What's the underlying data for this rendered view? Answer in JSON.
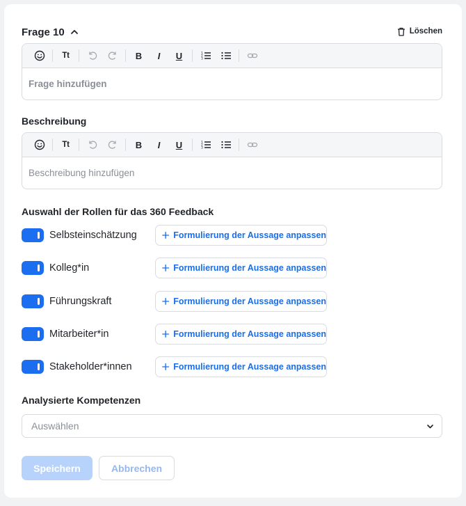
{
  "question": {
    "title": "Frage 10",
    "delete_label": "Löschen",
    "editor_placeholder": "Frage hinzufügen"
  },
  "description": {
    "label": "Beschreibung",
    "editor_placeholder": "Beschreibung hinzufügen"
  },
  "toolbar": {
    "textsize_label": "Tt",
    "bold_label": "B",
    "italic_label": "I",
    "underline_label": "U"
  },
  "roles": {
    "label": "Auswahl der Rollen für das 360 Feedback",
    "adjust_label": "Formulierung der Aussage anpassen",
    "items": [
      {
        "label": "Selbsteinschätzung",
        "enabled": true
      },
      {
        "label": "Kolleg*in",
        "enabled": true
      },
      {
        "label": "Führungskraft",
        "enabled": true
      },
      {
        "label": "Mitarbeiter*in",
        "enabled": true
      },
      {
        "label": "Stakeholder*innen",
        "enabled": true
      }
    ]
  },
  "competencies": {
    "label": "Analysierte Kompetenzen",
    "placeholder": "Auswählen"
  },
  "actions": {
    "save_label": "Speichern",
    "cancel_label": "Abbrechen"
  },
  "colors": {
    "accent": "#1b6ef0",
    "link": "#1a6ee8",
    "save_disabled": "#b7d2fb"
  }
}
